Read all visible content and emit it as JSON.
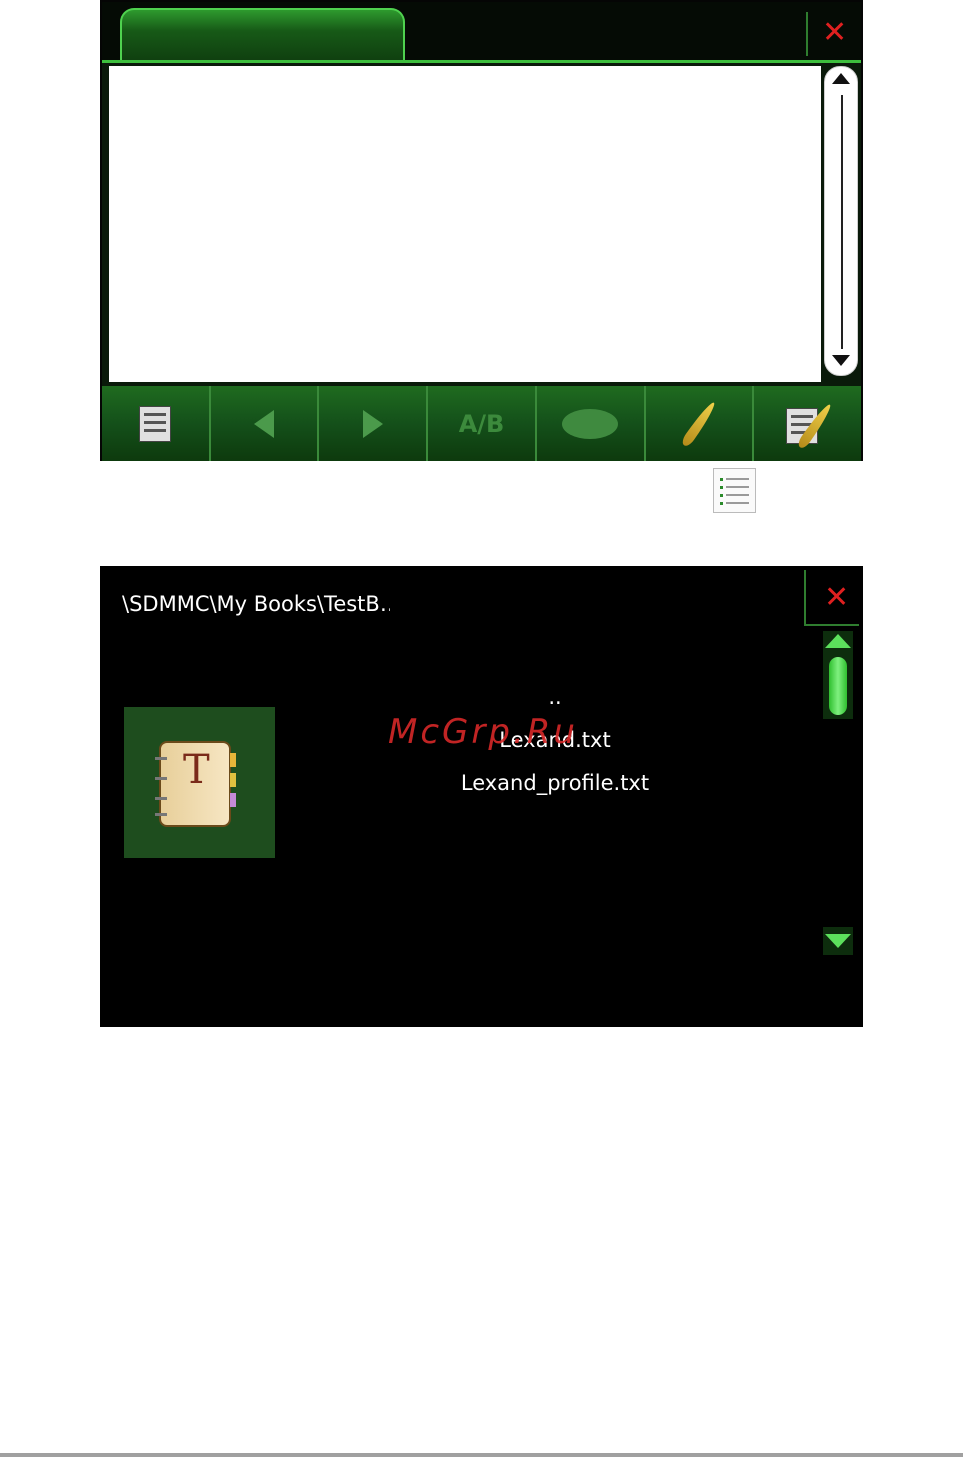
{
  "reader": {
    "tab_label": "",
    "close_glyph": "✕",
    "toolbar": {
      "ab_label": "A/B",
      "icons": [
        "contents-list-icon",
        "prev-page-icon",
        "next-page-icon",
        "ab-bookmark-icon",
        "palette-icon",
        "feather-icon",
        "notes-feather-icon"
      ]
    }
  },
  "browser": {
    "path": "\\SDMMC\\My Books\\TestB…",
    "close_glyph": "✕",
    "files": [
      "..",
      "Lexand.txt",
      "Lexand_profile.txt"
    ],
    "book_letter": "T",
    "watermark": "McGrp.Ru"
  },
  "colors": {
    "accent_green": "#3dbf3d",
    "close_red": "#e02020",
    "toolbar_green": "#1f6b1f",
    "tile_green": "#1e4d1e"
  }
}
